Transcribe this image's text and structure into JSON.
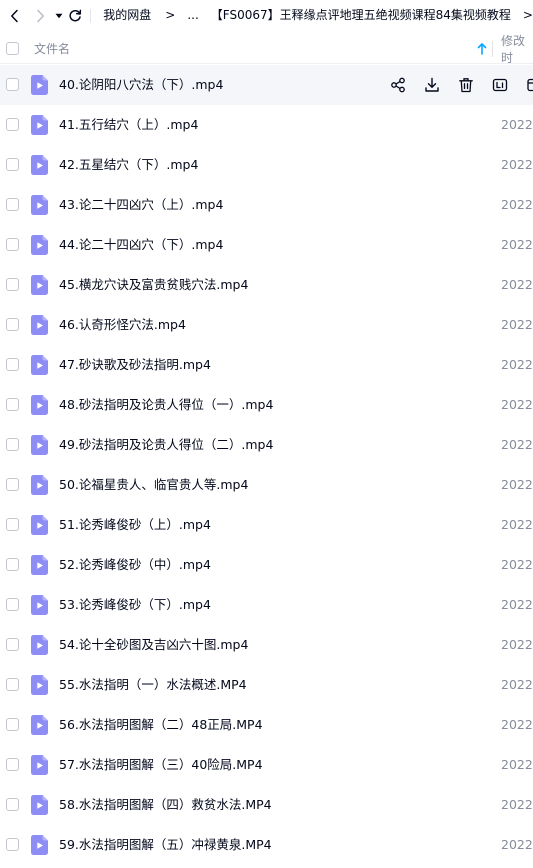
{
  "nav": {
    "back_icon": "chevron-left-icon",
    "forward_icon": "chevron-right-icon",
    "dropdown_icon": "caret-down-icon",
    "refresh_icon": "refresh-icon",
    "breadcrumb": [
      "我的网盘",
      ">",
      "...",
      "【FS0067】王释缘点评地理五绝视频课程84集视频教程",
      ">"
    ]
  },
  "header": {
    "name_column": "文件名",
    "modified_column": "修改时",
    "sort_icon": "arrow-up-icon"
  },
  "colors": {
    "accent": "#06a7ff",
    "file_icon": "#8e8df5",
    "muted_text": "#878c9c",
    "hover_row": "#f5f6fa"
  },
  "row_actions": [
    "share-icon",
    "download-icon",
    "delete-icon",
    "rename-icon",
    "more-icon"
  ],
  "files": [
    {
      "name": "40.论阴阳八穴法（下）.mp4",
      "modified": ""
    },
    {
      "name": "41.五行结穴（上）.mp4",
      "modified": "2022-"
    },
    {
      "name": "42.五星结穴（下）.mp4",
      "modified": "2022-"
    },
    {
      "name": "43.论二十四凶穴（上）.mp4",
      "modified": "2022-"
    },
    {
      "name": "44.论二十四凶穴（下）.mp4",
      "modified": "2022-"
    },
    {
      "name": "45.横龙穴诀及富贵贫贱穴法.mp4",
      "modified": "2022-"
    },
    {
      "name": "46.认奇形怪穴法.mp4",
      "modified": "2022-"
    },
    {
      "name": "47.砂诀歌及砂法指明.mp4",
      "modified": "2022-"
    },
    {
      "name": "48.砂法指明及论贵人得位（一）.mp4",
      "modified": "2022-"
    },
    {
      "name": "49.砂法指明及论贵人得位（二）.mp4",
      "modified": "2022-"
    },
    {
      "name": "50.论福星贵人、临官贵人等.mp4",
      "modified": "2022-"
    },
    {
      "name": "51.论秀峰俊砂（上）.mp4",
      "modified": "2022-"
    },
    {
      "name": "52.论秀峰俊砂（中）.mp4",
      "modified": "2022-"
    },
    {
      "name": "53.论秀峰俊砂（下）.mp4",
      "modified": "2022-"
    },
    {
      "name": "54.论十全砂图及吉凶六十图.mp4",
      "modified": "2022-"
    },
    {
      "name": "55.水法指明（一）水法概述.MP4",
      "modified": "2022-"
    },
    {
      "name": "56.水法指明图解（二）48正局.MP4",
      "modified": "2022-"
    },
    {
      "name": "57.水法指明图解（三）40险局.MP4",
      "modified": "2022-"
    },
    {
      "name": "58.水法指明图解（四）救贫水法.MP4",
      "modified": "2022-"
    },
    {
      "name": "59.水法指明图解（五）冲禄黄泉.MP4",
      "modified": "2022-"
    }
  ]
}
